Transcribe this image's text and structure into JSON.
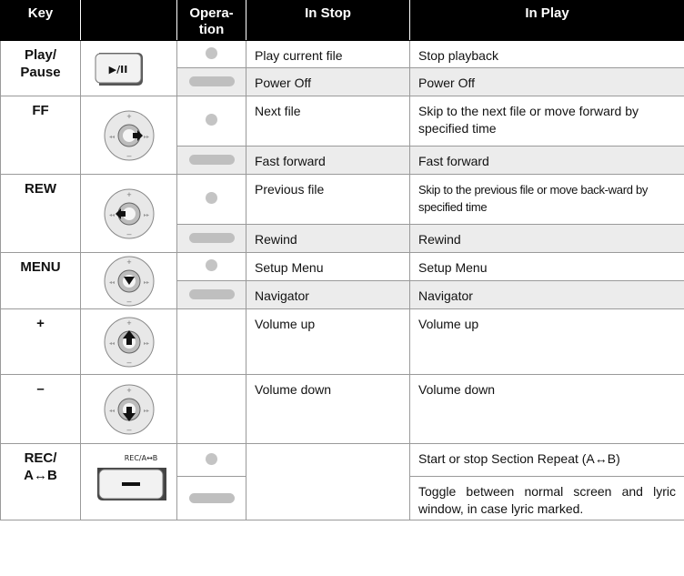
{
  "headers": {
    "key": "Key",
    "icon": "",
    "operation": "Opera-\ntion",
    "in_stop": "In Stop",
    "in_play": "In Play"
  },
  "rows": {
    "play_pause": {
      "key": "Play/\nPause",
      "button_label": "▶/II",
      "short": {
        "stop": "Play current file",
        "play": "Stop playback"
      },
      "long": {
        "stop": "Power Off",
        "play": "Power Off"
      }
    },
    "ff": {
      "key": "FF",
      "short": {
        "stop": "Next file",
        "play": "Skip to the next file or move forward by specified time"
      },
      "long": {
        "stop": "Fast forward",
        "play": "Fast forward"
      }
    },
    "rew": {
      "key": "REW",
      "short": {
        "stop": "Previous file",
        "play": "Skip to the previous file or move back-ward by specified time"
      },
      "long": {
        "stop": "Rewind",
        "play": "Rewind"
      }
    },
    "menu": {
      "key": "MENU",
      "short": {
        "stop": "Setup Menu",
        "play": "Setup Menu"
      },
      "long": {
        "stop": "Navigator",
        "play": "Navigator"
      }
    },
    "plus": {
      "key": "+",
      "stop": "Volume up",
      "play": "Volume up"
    },
    "minus": {
      "key": "–",
      "stop": "Volume down",
      "play": "Volume down"
    },
    "rec": {
      "key": "REC/\nA↔B",
      "button_caption": "REC/A↔B",
      "button_label": "–",
      "short": {
        "stop": "",
        "play": "Start or stop Section Repeat (A↔B)"
      },
      "long": {
        "stop": "",
        "play": "Toggle between normal screen and lyric window, in case lyric marked."
      }
    }
  },
  "jog_labels": {
    "top": "+",
    "bottom": "–",
    "left": "◂◂",
    "right": "▸▸"
  },
  "operation_icons": {
    "short": "short-press-dot",
    "long": "long-press-bar"
  },
  "colors": {
    "header_bg": "#000000",
    "header_text": "#ffffff",
    "shade": "#ececec",
    "grid": "#9a9a9a"
  }
}
